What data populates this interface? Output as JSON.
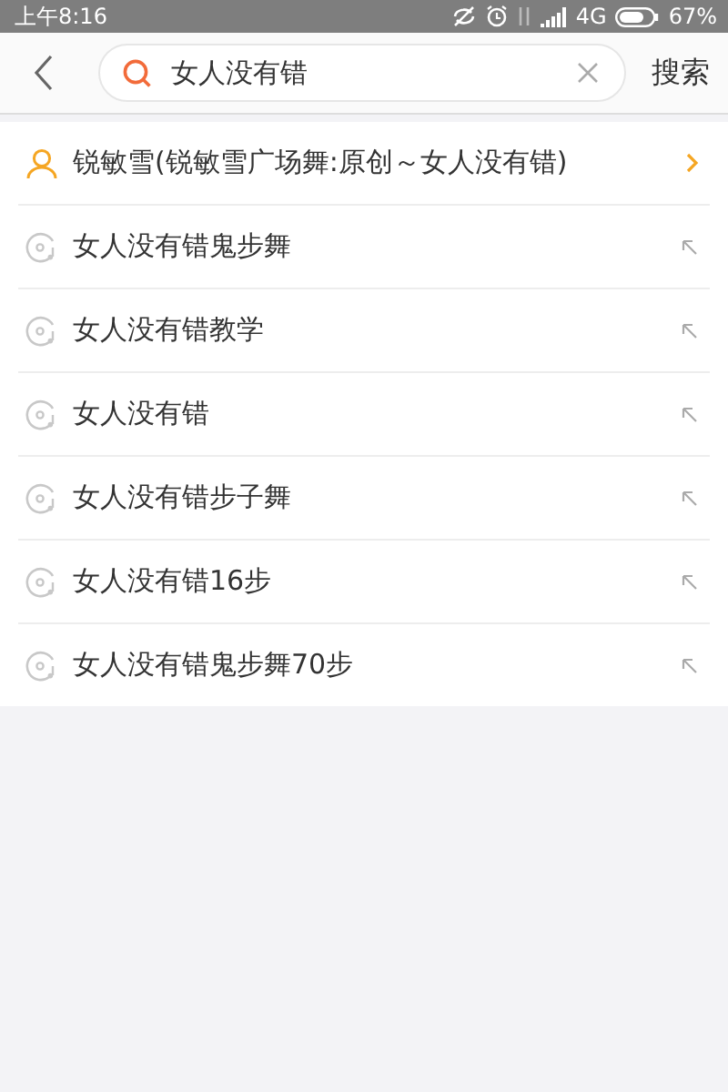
{
  "status_bar": {
    "time": "上午8:16",
    "network": "4G",
    "battery": "67%"
  },
  "search": {
    "value": "女人没有错",
    "button": "搜索"
  },
  "results": [
    {
      "kind": "artist",
      "text": "锐敏雪(锐敏雪广场舞:原创～女人没有错)"
    },
    {
      "kind": "suggestion",
      "text": "女人没有错鬼步舞"
    },
    {
      "kind": "suggestion",
      "text": "女人没有错教学"
    },
    {
      "kind": "suggestion",
      "text": "女人没有错"
    },
    {
      "kind": "suggestion",
      "text": "女人没有错步子舞"
    },
    {
      "kind": "suggestion",
      "text": "女人没有错16步"
    },
    {
      "kind": "suggestion",
      "text": "女人没有错鬼步舞70步"
    }
  ]
}
